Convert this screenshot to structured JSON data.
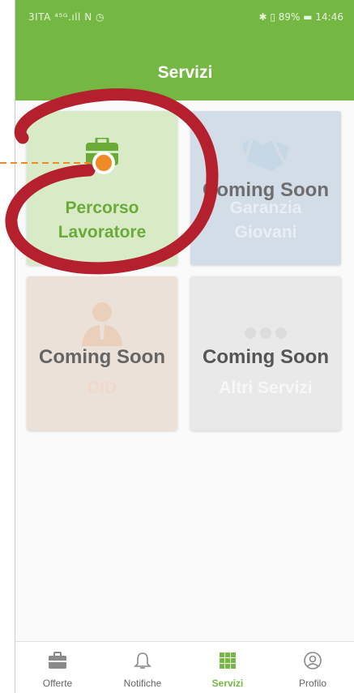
{
  "status_bar": {
    "left": "3ITA ⁴⁵ᴳ.ıll N ◷",
    "right": "✱ ▯ 89% ▬ 14:46"
  },
  "header": {
    "title": "Servizi"
  },
  "cards": [
    {
      "label_line1": "Percorso",
      "label_line2": "Lavoratore",
      "status": "",
      "icon": "briefcase-icon"
    },
    {
      "label_line1": "Garanzia",
      "label_line2": "Giovani",
      "status": "Coming Soon",
      "icon": "handshake-icon"
    },
    {
      "label_line1": "DID",
      "label_line2": "",
      "status": "Coming Soon",
      "icon": "person-icon"
    },
    {
      "label_line1": "Altri Servizi",
      "label_line2": "",
      "status": "Coming Soon",
      "icon": "dots-icon"
    }
  ],
  "tabbar": {
    "tabs": [
      {
        "label": "Offerte",
        "icon": "briefcase-icon"
      },
      {
        "label": "Notifiche",
        "icon": "bell-icon"
      },
      {
        "label": "Servizi",
        "icon": "grid-icon",
        "active": true
      },
      {
        "label": "Profilo",
        "icon": "profile-icon"
      }
    ]
  },
  "colors": {
    "primary": "#74b843",
    "annotation_ring": "#b5202e",
    "annotation_pointer": "#f08a24"
  }
}
